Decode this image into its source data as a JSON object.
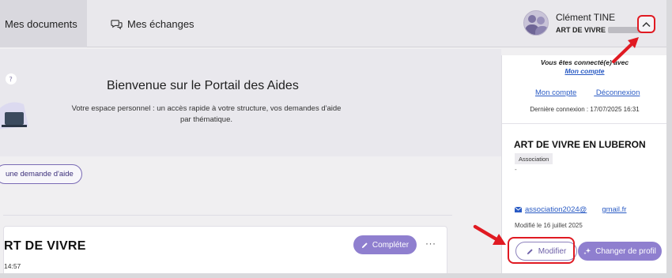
{
  "topbar": {
    "tabs": [
      {
        "label": "Mes documents",
        "active": true
      },
      {
        "label": "Mes échanges",
        "icon": "chat-bubbles-icon"
      }
    ],
    "user": {
      "name": "Clément TINE",
      "org": "ART DE VIVRE",
      "avatar": "avatar"
    },
    "menu_toggle_icon": "chevron-up-icon"
  },
  "welcome": {
    "title": "Bienvenue sur le Portail des Aides",
    "description": "Votre espace personnel : un accès rapide à votre structure, vos demandes d'aide par thématique."
  },
  "new_request_button": "une demande d'aide",
  "card": {
    "title": "RT DE VIVRE",
    "time": "14:57",
    "complete_button": "Compléter",
    "more_label": "···"
  },
  "panel": {
    "connected_as": "Vous êtes connecté(e)",
    "connected_as_tail": "avec",
    "my_account_link": "Mon compte",
    "links": {
      "account": "Mon compte",
      "logout": "Déconnexion"
    },
    "last_login": "Dernière connexion : 17/07/2025 16:31",
    "org_name": "ART DE VIVRE EN LUBERON",
    "org_type": "Association",
    "org_note": "-",
    "email_part1": "association2024@",
    "email_part2": "gmail.fr",
    "modified": "Modifié le 16 juillet 2025",
    "edit_button": "Modifier",
    "switch_profile_button": "Changer de profil"
  },
  "colors": {
    "accent": "#8f7fcf",
    "link": "#2a5bc4",
    "highlight": "#e01a22"
  }
}
